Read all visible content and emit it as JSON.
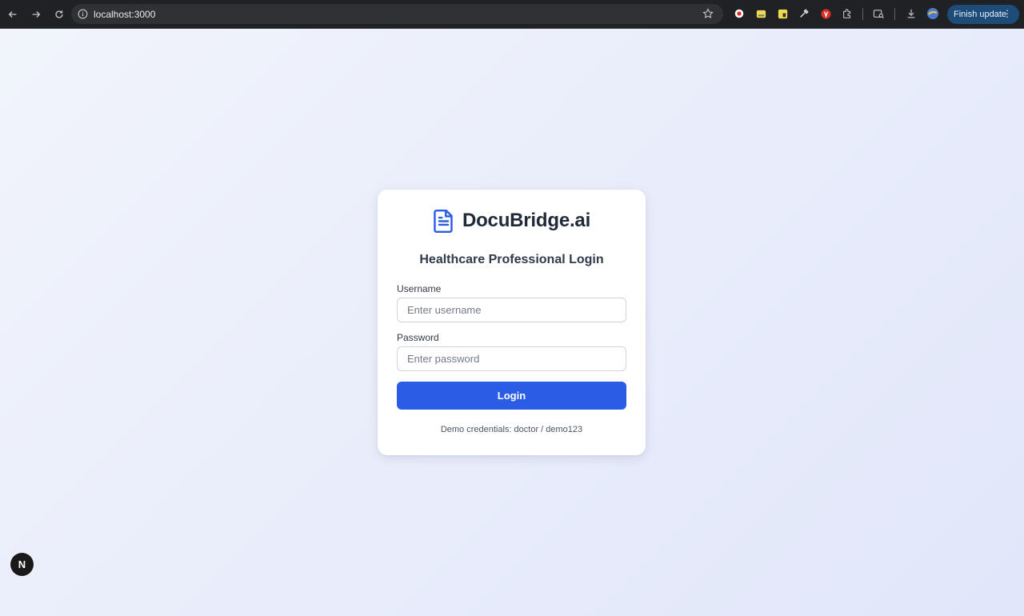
{
  "browser": {
    "url": "localhost:3000",
    "update_button_label": "Finish update",
    "icons": [
      "back-arrow-icon",
      "forward-arrow-icon",
      "reload-icon",
      "info-icon",
      "star-icon",
      "extension-icon",
      "puzzle-icon",
      "download-icon",
      "profile-icon",
      "menu-dots-icon"
    ]
  },
  "login": {
    "brand_name": "DocuBridge.ai",
    "brand_icon": "document-icon",
    "brand_color": "#2b5ce6",
    "subtitle": "Healthcare Professional Login",
    "username_label": "Username",
    "username_placeholder": "Enter username",
    "password_label": "Password",
    "password_placeholder": "Enter password",
    "login_button_label": "Login",
    "demo_text": "Demo credentials: doctor / demo123"
  },
  "dev_badge": {
    "label": "N"
  }
}
